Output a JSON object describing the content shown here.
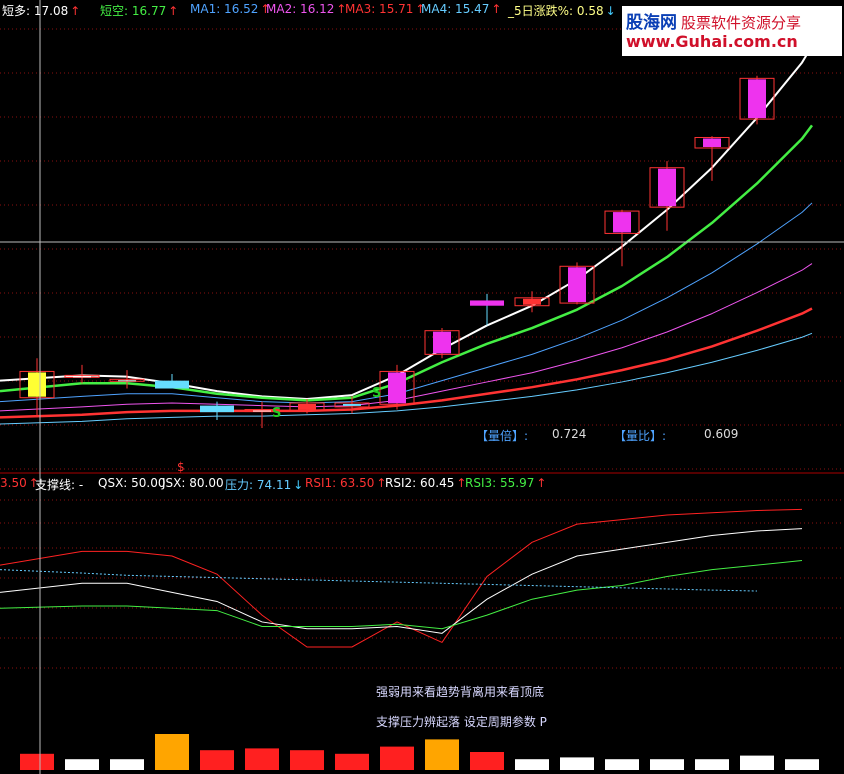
{
  "logo": {
    "brand": "股海网",
    "slogan": "股票软件资源分享",
    "url": "www.Guhai.com.cn"
  },
  "top_header": [
    {
      "label": "短多: ",
      "value": "17.08",
      "arrow": "↑",
      "color": "#ffffff"
    },
    {
      "label": "短空: ",
      "value": "16.77",
      "arrow": "↑",
      "color": "#44ee44"
    },
    {
      "label": "MA1: ",
      "value": "16.52",
      "arrow": "↑",
      "color": "#4fa3ff"
    },
    {
      "label": "MA2: ",
      "value": "16.12",
      "arrow": "↑",
      "color": "#ee55ee"
    },
    {
      "label": "MA3: ",
      "value": "15.71",
      "arrow": "↑",
      "color": "#ff3333"
    },
    {
      "label": "MA4: ",
      "value": "15.47",
      "arrow": "↑",
      "color": "#66ccff"
    },
    {
      "label": "_5日涨跌%: ",
      "value": "0.58",
      "arrow": "↓",
      "color": "#ffff88"
    }
  ],
  "ratio_labels": {
    "vol_multiple_label": "【量倍】:",
    "vol_multiple_value": "0.724",
    "vol_ratio_label": "【量比】:",
    "vol_ratio_value": "0.609"
  },
  "signals": {
    "s1": "S",
    "s2": "S",
    "dollar": "$"
  },
  "lower_header": [
    {
      "label": "",
      "value": "3.50",
      "arrow": "↑",
      "color": "#ff3333"
    },
    {
      "label": "支撑线: ",
      "value": "-",
      "arrow": "",
      "color": "#ffffff"
    },
    {
      "label": "QSX: ",
      "value": "50.00",
      "arrow": "",
      "color": "#ffffff"
    },
    {
      "label": "JSX: ",
      "value": "80.00",
      "arrow": "",
      "color": "#ffffff"
    },
    {
      "label": "压力: ",
      "value": "74.11",
      "arrow": "↓",
      "color": "#66ccff"
    },
    {
      "label": "RSI1: ",
      "value": "63.50",
      "arrow": "↑",
      "color": "#ff3333"
    },
    {
      "label": "RSI2: ",
      "value": "60.45",
      "arrow": "↑",
      "color": "#ffffff"
    },
    {
      "label": "RSI3: ",
      "value": "55.97",
      "arrow": "↑",
      "color": "#44ee44"
    }
  ],
  "notes": {
    "line1": "强弱用来看趋势背离用来看顶底",
    "line2": "支撑压力辨起落 设定周期参数 P"
  },
  "chart_data": [
    {
      "type": "candlestick",
      "panel": "main",
      "y_axis": "price",
      "candles": [
        {
          "open": 15.55,
          "high": 15.85,
          "low": 15.4,
          "close": 15.75,
          "color": "#ffff33"
        },
        {
          "open": 15.72,
          "high": 15.8,
          "low": 15.66,
          "close": 15.72,
          "color": "#ffffff"
        },
        {
          "open": 15.69,
          "high": 15.76,
          "low": 15.62,
          "close": 15.69,
          "color": "#ffffff"
        },
        {
          "open": 15.68,
          "high": 15.73,
          "low": 15.62,
          "close": 15.62,
          "color": "#66ddff"
        },
        {
          "open": 15.49,
          "high": 15.52,
          "low": 15.38,
          "close": 15.44,
          "color": "#66ddff"
        },
        {
          "open": 15.46,
          "high": 15.52,
          "low": 15.32,
          "close": 15.46,
          "color": "#ffffff"
        },
        {
          "open": 15.45,
          "high": 15.54,
          "low": 15.43,
          "close": 15.51,
          "color": "#ff3333"
        },
        {
          "open": 15.48,
          "high": 15.56,
          "low": 15.43,
          "close": 15.51,
          "color": "#66ddff"
        },
        {
          "open": 15.5,
          "high": 15.8,
          "low": 15.46,
          "close": 15.75,
          "color": "#ee33ee"
        },
        {
          "open": 15.88,
          "high": 16.08,
          "low": 15.85,
          "close": 16.06,
          "color": "#ee33ee"
        },
        {
          "open": 16.29,
          "high": 16.34,
          "low": 16.1,
          "close": 16.25,
          "color": "#ee33ee"
        },
        {
          "open": 16.25,
          "high": 16.36,
          "low": 16.2,
          "close": 16.31,
          "color": "#ff3333"
        },
        {
          "open": 16.27,
          "high": 16.58,
          "low": 16.26,
          "close": 16.55,
          "color": "#ee33ee"
        },
        {
          "open": 16.8,
          "high": 16.98,
          "low": 16.55,
          "close": 16.97,
          "color": "#ee33ee"
        },
        {
          "open": 17.0,
          "high": 17.35,
          "low": 16.82,
          "close": 17.3,
          "color": "#ee33ee"
        },
        {
          "open": 17.45,
          "high": 17.54,
          "low": 17.2,
          "close": 17.53,
          "color": "#ee33ee"
        },
        {
          "open": 17.67,
          "high": 18.0,
          "low": 17.63,
          "close": 17.98,
          "color": "#ee33ee"
        },
        {
          "open": 18.25,
          "high": 18.36,
          "low": 18.23,
          "close": 18.32,
          "color": "#ee33ee"
        }
      ],
      "series": [
        {
          "name": "短多",
          "color": "#ffffff",
          "width": 2,
          "values": [
            15.68,
            15.72,
            15.71,
            15.66,
            15.6,
            15.56,
            15.54,
            15.57,
            15.72,
            15.92,
            16.1,
            16.25,
            16.45,
            16.7,
            16.98,
            17.3,
            17.68,
            18.1
          ]
        },
        {
          "name": "短空",
          "color": "#44ee44",
          "width": 2.5,
          "values": [
            15.6,
            15.66,
            15.66,
            15.63,
            15.58,
            15.55,
            15.53,
            15.55,
            15.66,
            15.82,
            15.96,
            16.08,
            16.22,
            16.4,
            16.62,
            16.88,
            17.18,
            17.52
          ]
        },
        {
          "name": "MA1",
          "color": "#4fa3ff",
          "width": 1,
          "values": [
            15.52,
            15.56,
            15.58,
            15.58,
            15.55,
            15.52,
            15.51,
            15.52,
            15.58,
            15.68,
            15.78,
            15.88,
            16.0,
            16.14,
            16.31,
            16.5,
            16.72,
            16.96
          ]
        },
        {
          "name": "MA2",
          "color": "#ee55ee",
          "width": 1,
          "values": [
            15.45,
            15.48,
            15.5,
            15.51,
            15.5,
            15.49,
            15.48,
            15.49,
            15.53,
            15.6,
            15.67,
            15.74,
            15.83,
            15.93,
            16.05,
            16.19,
            16.35,
            16.52
          ]
        },
        {
          "name": "MA3",
          "color": "#ff3333",
          "width": 2.5,
          "values": [
            15.4,
            15.42,
            15.44,
            15.45,
            15.45,
            15.45,
            15.45,
            15.46,
            15.49,
            15.53,
            15.58,
            15.63,
            15.69,
            15.76,
            15.84,
            15.94,
            16.06,
            16.19
          ]
        },
        {
          "name": "MA4",
          "color": "#66ccff",
          "width": 1,
          "values": [
            15.35,
            15.37,
            15.39,
            15.4,
            15.41,
            15.41,
            15.42,
            15.43,
            15.45,
            15.48,
            15.52,
            15.56,
            15.61,
            15.67,
            15.74,
            15.82,
            15.91,
            16.01
          ]
        }
      ]
    },
    {
      "type": "line",
      "panel": "indicator",
      "y_axis": "RSI",
      "series": [
        {
          "name": "RSI1",
          "color": "#ff2222",
          "values": [
            62,
            68,
            68,
            66,
            58,
            40,
            26,
            26,
            37,
            28,
            57,
            72,
            80,
            82,
            84,
            85,
            86,
            86.5
          ]
        },
        {
          "name": "RSI2",
          "color": "#ffffff",
          "values": [
            50,
            54,
            54,
            50,
            46,
            37,
            34,
            34,
            35,
            32,
            47,
            58,
            66,
            69,
            72,
            75,
            77,
            78
          ]
        },
        {
          "name": "RSI3",
          "color": "#44ee44",
          "values": [
            43,
            44,
            44,
            43,
            42,
            35,
            35,
            35,
            36,
            34,
            40,
            47,
            51,
            53,
            57,
            60,
            62,
            64
          ]
        },
        {
          "name": "压力",
          "color": "#66ccff",
          "dashed": true,
          "values": [
            60,
            58.5,
            57.5,
            57,
            56.5,
            56,
            55.5,
            55,
            54.5,
            54,
            53.5,
            53,
            52.5,
            52,
            51.5,
            51,
            50.6
          ]
        }
      ]
    },
    {
      "type": "bar",
      "panel": "volume",
      "values": [
        0.45,
        0.3,
        0.3,
        1.0,
        0.55,
        0.6,
        0.55,
        0.45,
        0.65,
        0.85,
        0.5,
        0.3,
        0.35,
        0.3,
        0.3,
        0.3,
        0.4,
        0.3
      ],
      "colors": [
        "#ff2020",
        "#ffffff",
        "#ffffff",
        "#ffa500",
        "#ff2020",
        "#ff2020",
        "#ff2020",
        "#ff2020",
        "#ff2020",
        "#ffa500",
        "#ff2020",
        "#ffffff",
        "#ffffff",
        "#ffffff",
        "#ffffff",
        "#ffffff",
        "#ffffff",
        "#ffffff"
      ]
    }
  ]
}
